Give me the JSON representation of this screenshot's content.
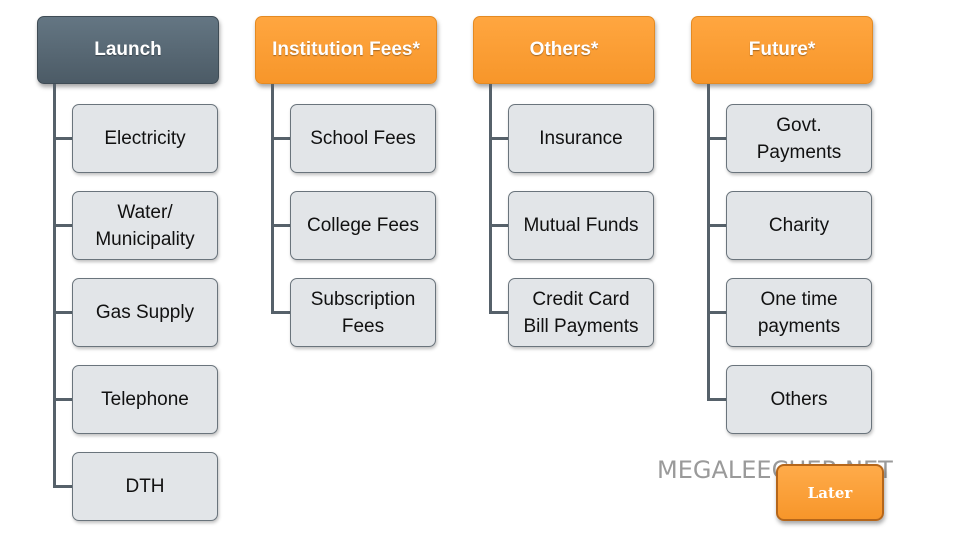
{
  "columns": [
    {
      "title": "Launch",
      "style": "dark",
      "items": [
        "Electricity",
        "Water/\nMunicipality",
        "Gas Supply",
        "Telephone",
        "DTH"
      ]
    },
    {
      "title": "Institution Fees*",
      "style": "orange",
      "items": [
        "School Fees",
        "College Fees",
        "Subscription\nFees"
      ]
    },
    {
      "title": "Others*",
      "style": "orange",
      "items": [
        "Insurance",
        "Mutual Funds",
        "Credit Card\nBill Payments"
      ]
    },
    {
      "title": "Future*",
      "style": "orange",
      "items": [
        "Govt.\nPayments",
        "Charity",
        "One time\npayments",
        "Others"
      ]
    }
  ],
  "later_label": "Later",
  "watermark": "MEGALEECHER.NET",
  "colors": {
    "dark_header": "#56656f",
    "orange_header": "#f99d33",
    "item_fill": "#e2e5e8",
    "connector": "#56616a"
  }
}
